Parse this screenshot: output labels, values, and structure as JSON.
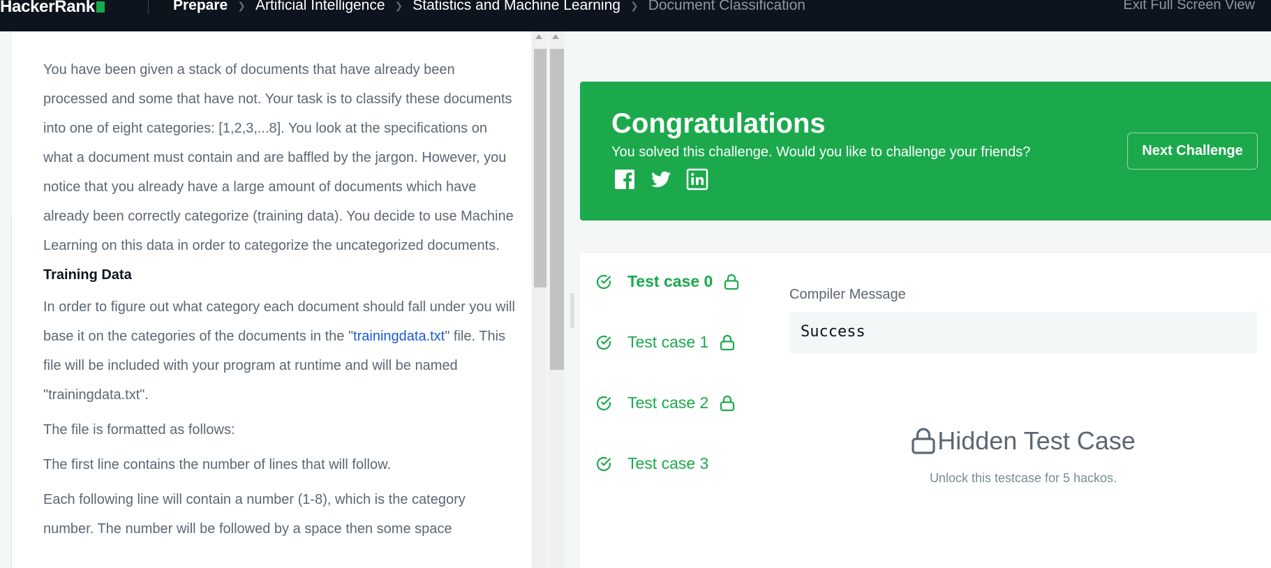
{
  "topbar": {
    "logo": "HackerRank",
    "breadcrumbs": [
      "Prepare",
      "Artificial Intelligence",
      "Statistics and Machine Learning",
      "Document Classification"
    ],
    "exit_fullscreen": "Exit Full Screen View"
  },
  "problem": {
    "intro": "You have been given a stack of documents that have already been processed and some that have not. Your task is to classify these documents into one of eight categories: [1,2,3,...8]. You look at the specifications on what a document must contain and are baffled by the jargon. However, you notice that you already have a large amount of documents which have already been correctly categorize (training data). You decide to use Machine Learning on this data in order to categorize the uncategorized documents.",
    "training_heading": "Training Data",
    "training_pre": "In order to figure out what category each document should fall under you will base it on the categories of the documents in the \"",
    "training_link": "trainingdata.txt",
    "training_post": "\" file. This file will be included with your program at runtime and will be named \"trainingdata.txt\".",
    "format_intro": "The file is formatted as follows:",
    "first_line": "The first line contains the number of lines that will follow.",
    "following": "Each following line will contain a number (1-8), which is the category number. The number will be followed by a space then some space"
  },
  "congrats": {
    "title": "Congratulations",
    "subtitle": "You solved this challenge. Would you like to challenge your friends?",
    "next_button": "Next Challenge",
    "social_icons": [
      "facebook-icon",
      "twitter-icon",
      "linkedin-icon"
    ],
    "background": "#1ba94c"
  },
  "test_cases": [
    {
      "label": "Test case 0",
      "locked": true,
      "active": true
    },
    {
      "label": "Test case 1",
      "locked": true,
      "active": false
    },
    {
      "label": "Test case 2",
      "locked": true,
      "active": false
    },
    {
      "label": "Test case 3",
      "locked": false,
      "active": false
    }
  ],
  "compiler": {
    "label": "Compiler Message",
    "message": "Success"
  },
  "hidden": {
    "title": "Hidden Test Case",
    "subtitle": "Unlock this testcase for 5 hackos."
  },
  "colors": {
    "accent": "#1ba94c",
    "topbar": "#0e141e",
    "link": "#1a5ad7"
  }
}
